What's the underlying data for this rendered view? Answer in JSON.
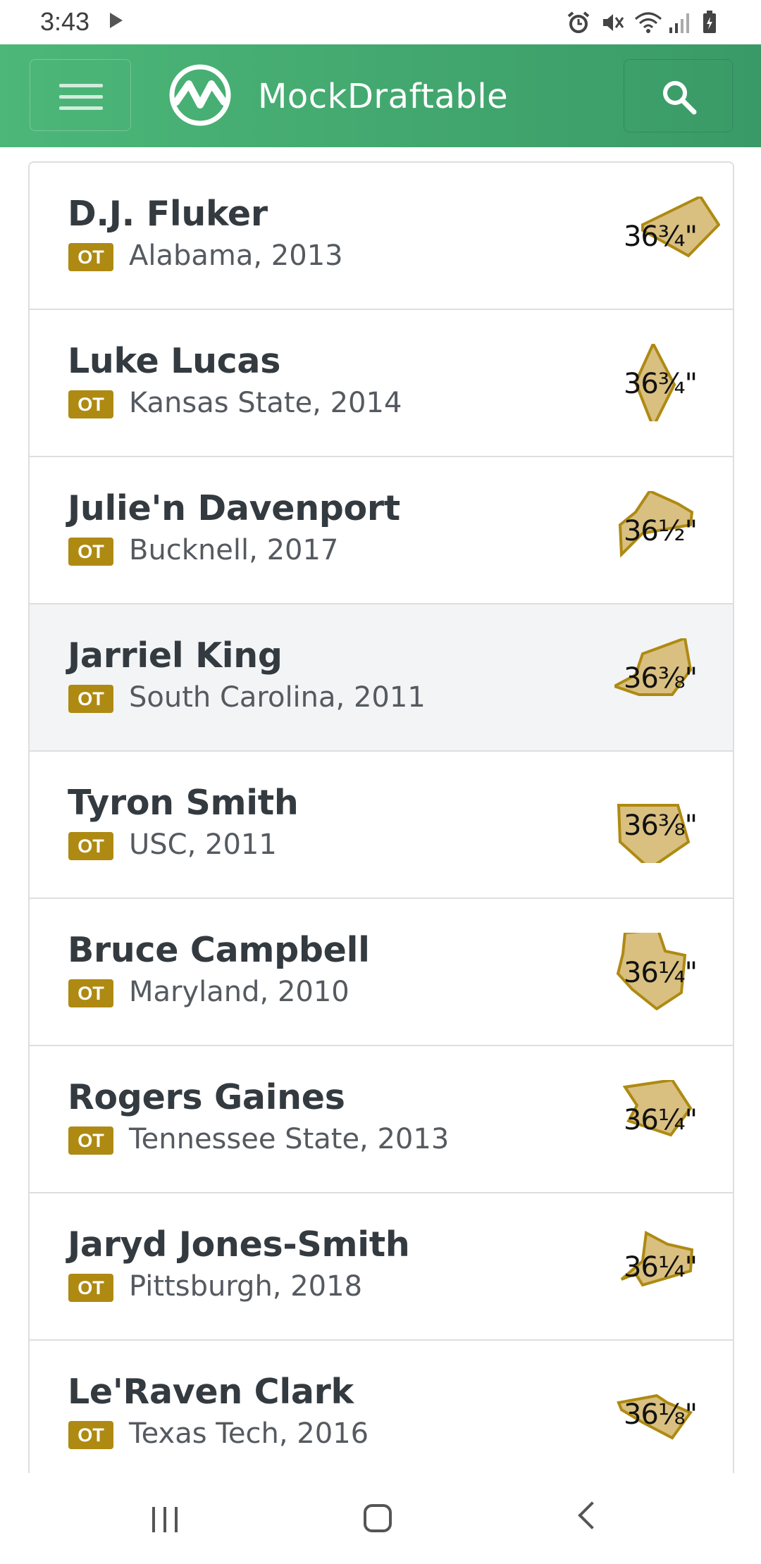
{
  "status_bar": {
    "time": "3:43",
    "icons": [
      "play-icon",
      "alarm-icon",
      "mute-icon",
      "wifi-icon",
      "signal-icon",
      "battery-icon"
    ]
  },
  "app_bar": {
    "title": "MockDraftable",
    "menu_icon": "menu-icon",
    "search_icon": "search-icon"
  },
  "colors": {
    "header_start": "#4cb778",
    "header_end": "#3a9a67",
    "badge": "#ae8a12",
    "shape_fill": "#d9c081",
    "shape_stroke": "#ae8a12"
  },
  "players": [
    {
      "name": "D.J. Fluker",
      "position": "OT",
      "school": "Alabama, 2013",
      "arm": "36¾\""
    },
    {
      "name": "Luke Lucas",
      "position": "OT",
      "school": "Kansas State, 2014",
      "arm": "36¾\""
    },
    {
      "name": "Julie'n Davenport",
      "position": "OT",
      "school": "Bucknell, 2017",
      "arm": "36½\""
    },
    {
      "name": "Jarriel King",
      "position": "OT",
      "school": "South Carolina, 2011",
      "arm": "36⅜\""
    },
    {
      "name": "Tyron Smith",
      "position": "OT",
      "school": "USC, 2011",
      "arm": "36⅜\""
    },
    {
      "name": "Bruce Campbell",
      "position": "OT",
      "school": "Maryland, 2010",
      "arm": "36¼\""
    },
    {
      "name": "Rogers Gaines",
      "position": "OT",
      "school": "Tennessee State, 2013",
      "arm": "36¼\""
    },
    {
      "name": "Jaryd Jones-Smith",
      "position": "OT",
      "school": "Pittsburgh, 2018",
      "arm": "36¼\""
    },
    {
      "name": "Le'Raven Clark",
      "position": "OT",
      "school": "Texas Tech, 2016",
      "arm": "36⅛\""
    }
  ]
}
